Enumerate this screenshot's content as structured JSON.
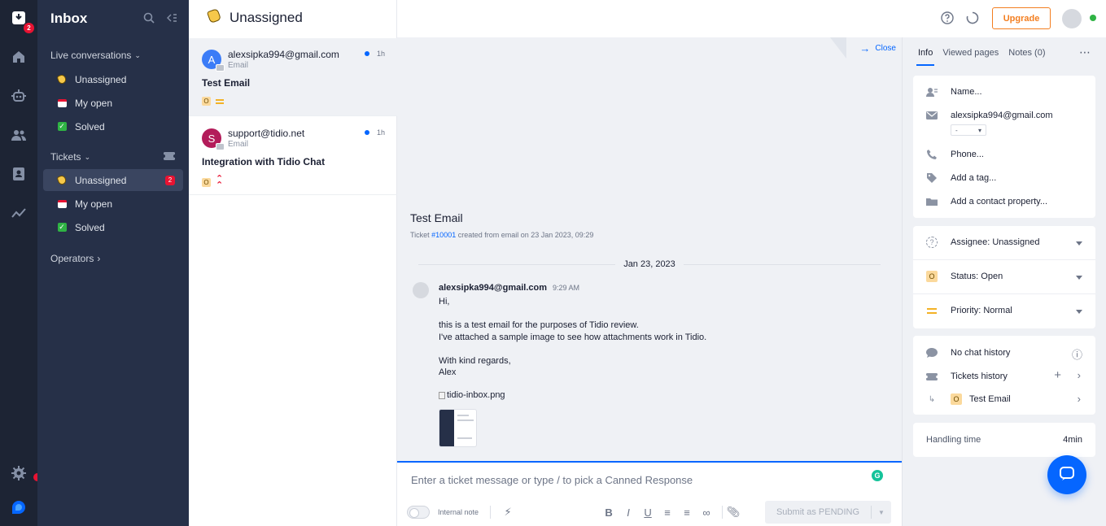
{
  "rail": {
    "inbox_badge": "2",
    "icons": [
      "inbox-icon",
      "home-icon",
      "bot-icon",
      "visitors-icon",
      "contacts-icon",
      "analytics-icon",
      "settings-icon",
      "tidio-logo-icon"
    ]
  },
  "sidebar": {
    "title": "Inbox",
    "live_section": "Live conversations",
    "live_items": [
      {
        "label": "Unassigned"
      },
      {
        "label": "My open"
      },
      {
        "label": "Solved"
      }
    ],
    "tickets_section": "Tickets",
    "ticket_items": [
      {
        "label": "Unassigned",
        "count": "2"
      },
      {
        "label": "My open"
      },
      {
        "label": "Solved"
      }
    ],
    "operators_section": "Operators"
  },
  "list": {
    "title": "Unassigned",
    "conversations": [
      {
        "avatar_letter": "A",
        "avatar_color": "#3b7cf7",
        "from": "alexsipka994@gmail.com",
        "channel": "Email",
        "time": "1h",
        "subject": "Test Email",
        "status": "O"
      },
      {
        "avatar_letter": "S",
        "avatar_color": "#b31c5a",
        "from": "support@tidio.net",
        "channel": "Email",
        "time": "1h",
        "subject": "Integration with Tidio Chat",
        "status": "O"
      }
    ]
  },
  "header": {
    "upgrade_label": "Upgrade"
  },
  "main": {
    "close_label": "Close",
    "ticket_title": "Test Email",
    "ticket_prefix": "Ticket ",
    "ticket_id": "#10001",
    "ticket_suffix": " created from email on 23 Jan 2023, 09:29",
    "date_separator": "Jan 23, 2023",
    "message": {
      "from": "alexsipka994@gmail.com",
      "time": "9:29 AM",
      "body": "Hi,\n\nthis is a test email for the purposes of Tidio review.\nI've attached a sample image to see how attachments work in Tidio.\n\nWith kind regards,\nAlex",
      "attachment": "tidio-inbox.png"
    }
  },
  "composer": {
    "placeholder": "Enter a ticket message or type / to pick a Canned Response",
    "internal_note_label": "Internal note",
    "submit_label": "Submit as PENDING"
  },
  "info": {
    "tabs": [
      "Info",
      "Viewed pages",
      "Notes (0)"
    ],
    "name_placeholder": "Name...",
    "email": "alexsipka994@gmail.com",
    "email_select": "-",
    "phone_placeholder": "Phone...",
    "tag_placeholder": "Add a tag...",
    "property_placeholder": "Add a contact property...",
    "assignee": "Assignee: Unassigned",
    "status_badge": "O",
    "status": "Status: Open",
    "priority": "Priority: Normal",
    "no_chat_history": "No chat history",
    "tickets_history": "Tickets history",
    "history_ticket_badge": "O",
    "history_ticket": "Test Email",
    "handling_time_label": "Handling time",
    "handling_time_value": "4min"
  }
}
